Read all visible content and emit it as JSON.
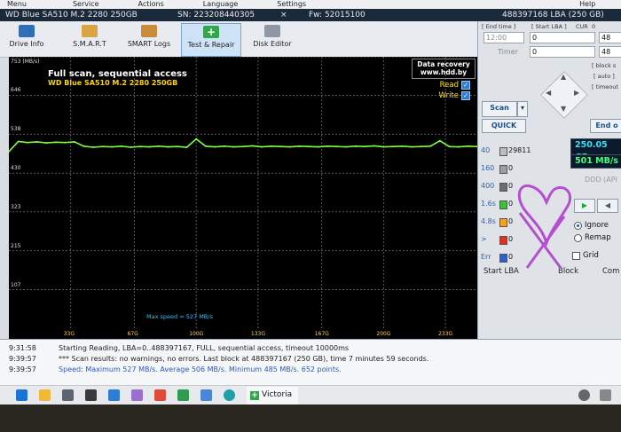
{
  "menu": [
    "Menu",
    "Service",
    "Actions",
    "Language",
    "Settings",
    "Help"
  ],
  "info_bar": {
    "model": "WD Blue SA510 M.2 2280 250GB",
    "serial": "SN: 223208440305",
    "close": "×",
    "firmware": "Fw: 52015100",
    "lba": "488397168 LBA (250 GB)"
  },
  "toolbar": {
    "items": [
      {
        "label": "Drive Info",
        "icon": "drive-info-icon"
      },
      {
        "label": "S.M.A.R.T",
        "icon": "smart-icon"
      },
      {
        "label": "SMART Logs",
        "icon": "smart-logs-icon"
      },
      {
        "label": "Test & Repair",
        "icon": "plus-icon"
      },
      {
        "label": "Disk Editor",
        "icon": "disk-editor-icon"
      }
    ]
  },
  "graph": {
    "unit": "753 (MB/s)",
    "title": "Full scan, sequential access",
    "subtitle": "WD Blue SA510 M.2 2280 250GB",
    "badge_line1": "Data recovery",
    "badge_line2": "www.hdd.by",
    "legend_read": "Read",
    "legend_write": "Write",
    "max_speed": "Max speed = 527 MB/s"
  },
  "chart_data": {
    "type": "line",
    "title": "Full scan, sequential access",
    "ylim": [
      0,
      753
    ],
    "y_ticks": [
      "646",
      "538",
      "430",
      "323",
      "215",
      "107"
    ],
    "x_ticks": [
      "33G",
      "67G",
      "100G",
      "133G",
      "167G",
      "200G",
      "233G"
    ],
    "series": [
      {
        "name": "Read",
        "x": [
          0,
          5,
          10,
          15,
          20,
          25,
          30,
          35,
          40,
          45,
          50,
          55,
          60,
          65,
          70,
          75,
          80,
          85,
          90,
          95,
          100,
          105,
          110,
          115,
          120,
          125,
          130,
          135,
          140,
          145,
          150,
          155,
          160,
          165,
          170,
          175,
          180,
          185,
          190,
          195,
          200,
          205,
          210,
          215,
          220,
          225,
          230,
          235,
          240,
          245,
          250
        ],
        "values": [
          490,
          518,
          515,
          517,
          514,
          516,
          515,
          517,
          505,
          502,
          504,
          503,
          505,
          502,
          504,
          503,
          505,
          503,
          504,
          502,
          525,
          505,
          503,
          505,
          503,
          504,
          506,
          503,
          505,
          504,
          503,
          505,
          504,
          503,
          505,
          504,
          503,
          505,
          504,
          506,
          503,
          504,
          505,
          503,
          504,
          505,
          520,
          504,
          503,
          505,
          504
        ]
      }
    ]
  },
  "right_panel": {
    "end_time_label": "[ End time ]",
    "start_lba_label": "[ Start LBA ]",
    "cur_label": "CUR",
    "end_value": "0",
    "time_value": "12:00",
    "start_lba_value": "0",
    "right_value_1": "48",
    "timer_label": "Timer",
    "timer_value": "0",
    "right_value_2": "48",
    "block_label": "[ block s",
    "auto_label": "[ auto ]",
    "timeout_label": "[ timeout",
    "scan_button": "Scan",
    "quick_button": "QUICK",
    "end_button": "End o",
    "capacity": "250.05 GB",
    "speed": "501 MB/s",
    "ddd_label": "DDD (API",
    "ignore_label": "Ignore",
    "remap_label": "Remap",
    "grid_label": "Grid",
    "counters": [
      {
        "label": "40",
        "value": "29811",
        "color": "#bdbdbd"
      },
      {
        "label": "160",
        "value": "0",
        "color": "#9e9e9e"
      },
      {
        "label": "400",
        "value": "0",
        "color": "#6d6d6d"
      },
      {
        "label": "1.6s",
        "value": "0",
        "color": "#3cc13c"
      },
      {
        "label": "4.8s",
        "value": "0",
        "color": "#f2a21b"
      },
      {
        "label": ">",
        "value": "0",
        "color": "#e0301e"
      },
      {
        "label": "Err",
        "value": "0",
        "color": "#2a62c9"
      }
    ],
    "tabs": [
      "Start LBA",
      "Block",
      "Com"
    ]
  },
  "log": [
    {
      "time": "9:31:58",
      "text": "Starting Reading, LBA=0..488397167, FULL, sequential access, timeout 10000ms",
      "color": "#222222"
    },
    {
      "time": "9:39:57",
      "text": "*** Scan results: no warnings, no errors. Last block at 488397167 (250 GB), time 7 minutes 59 seconds.",
      "color": "#222222"
    },
    {
      "time": "9:39:57",
      "text": "Speed: Maximum 527 MB/s. Average 506 MB/s. Minimum 485 MB/s. 652 points.",
      "color": "#2b59c3"
    }
  ],
  "taskbar": {
    "active_app": "Victoria"
  }
}
